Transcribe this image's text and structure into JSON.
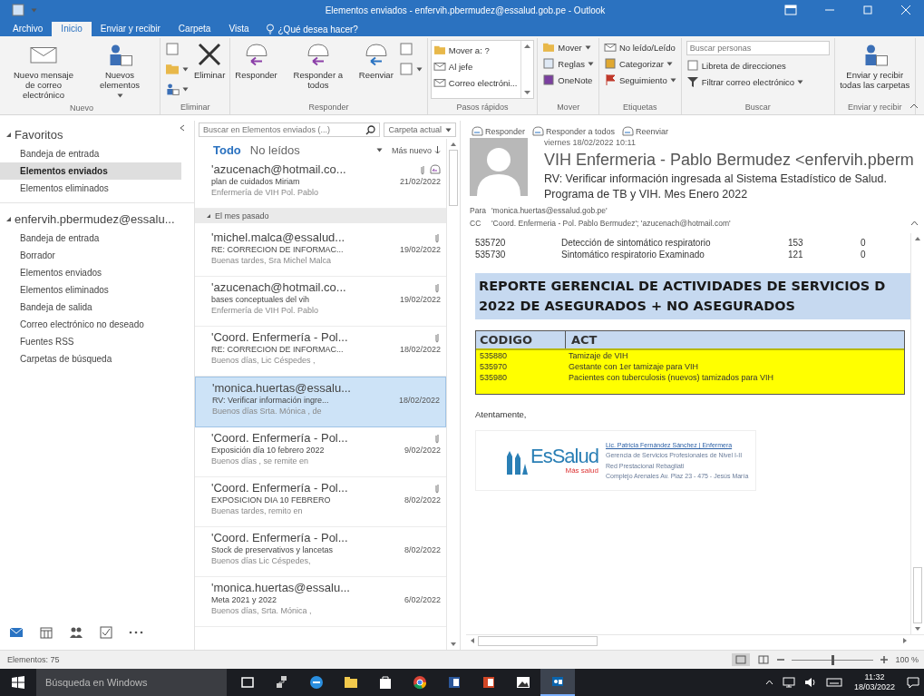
{
  "window": {
    "title": "Elementos enviados - enfervih.pbermudez@essalud.gob.pe - Outlook"
  },
  "ribbon_tabs": [
    {
      "label": "Archivo",
      "selected": false
    },
    {
      "label": "Inicio",
      "selected": true
    },
    {
      "label": "Enviar y recibir",
      "selected": false
    },
    {
      "label": "Carpeta",
      "selected": false
    },
    {
      "label": "Vista",
      "selected": false
    }
  ],
  "tell_me": {
    "placeholder": "¿Qué desea hacer?"
  },
  "ribbon_groups": [
    {
      "label": "Nuevo",
      "boxed": false,
      "buttons": [
        {
          "kind": "large",
          "label": "Nuevo mensaje de correo electrónico",
          "caret": false
        },
        {
          "kind": "large",
          "label": "Nuevos elementos",
          "caret": true
        }
      ]
    },
    {
      "label": "Eliminar",
      "boxed": false,
      "buttons": [
        {
          "kind": "icon",
          "caret": false
        },
        {
          "kind": "icon",
          "caret": true
        },
        {
          "kind": "icon",
          "caret": true
        },
        {
          "kind": "large",
          "label": "Eliminar",
          "caret": false
        }
      ]
    },
    {
      "label": "Responder",
      "boxed": false,
      "buttons": [
        {
          "kind": "large",
          "label": "Responder",
          "caret": false
        },
        {
          "kind": "large",
          "label": "Responder a todos",
          "caret": false
        },
        {
          "kind": "large",
          "label": "Reenviar",
          "caret": false
        },
        {
          "kind": "icon",
          "caret": false
        },
        {
          "kind": "icon",
          "caret": true
        }
      ]
    },
    {
      "label": "Pasos rápidos",
      "boxed": true,
      "buttons": [
        {
          "kind": "small",
          "label": "Mover a: ?",
          "caret": false
        },
        {
          "kind": "small",
          "label": "Al jefe",
          "caret": false
        },
        {
          "kind": "small",
          "label": "Correo electróni...",
          "caret": false
        }
      ]
    },
    {
      "label": "Mover",
      "boxed": false,
      "buttons": [
        {
          "kind": "small",
          "label": "Mover",
          "caret": true
        },
        {
          "kind": "small",
          "label": "Reglas",
          "caret": true
        },
        {
          "kind": "small",
          "label": "OneNote",
          "caret": false
        }
      ]
    },
    {
      "label": "Etiquetas",
      "boxed": false,
      "buttons": [
        {
          "kind": "small",
          "label": "No leído/Leído",
          "caret": false
        },
        {
          "kind": "small",
          "label": "Categorizar",
          "caret": true
        },
        {
          "kind": "small",
          "label": "Seguimiento",
          "caret": true
        }
      ]
    },
    {
      "label": "Buscar",
      "boxed": false,
      "buttons": [
        {
          "kind": "field",
          "placeholder": "Buscar personas"
        },
        {
          "kind": "small",
          "label": "Libreta de direcciones",
          "caret": false
        },
        {
          "kind": "small",
          "label": "Filtrar correo electrónico",
          "caret": true
        }
      ]
    },
    {
      "label": "Enviar y recibir",
      "boxed": false,
      "buttons": [
        {
          "kind": "large",
          "label": "Enviar y recibir todas las carpetas",
          "caret": false
        }
      ]
    }
  ],
  "folder_sections": [
    {
      "title": "Favoritos",
      "expanded": true,
      "items": [
        {
          "label": "Bandeja de entrada",
          "selected": false
        },
        {
          "label": "Elementos enviados",
          "selected": true
        },
        {
          "label": "Elementos eliminados",
          "selected": false
        }
      ]
    },
    {
      "title": "enfervih.pbermudez@essalu...",
      "expanded": true,
      "items": [
        {
          "label": "Bandeja de entrada",
          "selected": false
        },
        {
          "label": "Borrador",
          "selected": false
        },
        {
          "label": "Elementos enviados",
          "selected": false
        },
        {
          "label": "Elementos eliminados",
          "selected": false
        },
        {
          "label": "Bandeja de salida",
          "selected": false
        },
        {
          "label": "Correo electrónico no deseado",
          "selected": false
        },
        {
          "label": "Fuentes RSS",
          "selected": false
        },
        {
          "label": "Carpetas de búsqueda",
          "selected": false
        }
      ]
    }
  ],
  "message_list": {
    "search": {
      "placeholder": "Buscar en Elementos enviados (...)"
    },
    "scope": "Carpeta actual",
    "filters": [
      {
        "label": "Todo",
        "selected": true
      },
      {
        "label": "No leídos",
        "selected": false
      }
    ],
    "sort": "Más nuevo",
    "items": [
      {
        "kind": "message",
        "from": "'azucenach@hotmail.co...",
        "subject": "plan de cuidados Miriam",
        "preview": "Enfermería de VIH Pol. Pablo",
        "date": "21/02/2022",
        "attachment": true,
        "replied": true,
        "selected": false
      },
      {
        "kind": "header",
        "label": "El mes pasado",
        "expanded": true
      },
      {
        "kind": "message",
        "from": "'michel.malca@essalud...",
        "subject": "RE: CORRECION DE INFORMAC...",
        "preview": "Buenas tardes, Sra Michel Malca",
        "date": "19/02/2022",
        "attachment": true,
        "replied": false,
        "selected": false
      },
      {
        "kind": "message",
        "from": "'azucenach@hotmail.co...",
        "subject": "bases conceptuales del vih",
        "preview": "Enfermería de VIH Pol. Pablo",
        "date": "19/02/2022",
        "attachment": true,
        "replied": false,
        "selected": false
      },
      {
        "kind": "message",
        "from": "'Coord. Enfermería - Pol...",
        "subject": "RE: CORRECION DE INFORMAC...",
        "preview": "Buenos días, Lic Céspedes ,",
        "date": "18/02/2022",
        "attachment": true,
        "replied": false,
        "selected": false
      },
      {
        "kind": "message",
        "from": "'monica.huertas@essalu...",
        "subject": "RV: Verificar información ingre...",
        "preview": "Buenos días Srta. Mónica , de",
        "date": "18/02/2022",
        "attachment": false,
        "replied": false,
        "selected": true
      },
      {
        "kind": "message",
        "from": "'Coord. Enfermería - Pol...",
        "subject": "Exposición día 10 febrero 2022",
        "preview": "Buenos días , se remite en",
        "date": "9/02/2022",
        "attachment": true,
        "replied": false,
        "selected": false
      },
      {
        "kind": "message",
        "from": "'Coord. Enfermería - Pol...",
        "subject": "EXPOSICION DIA 10 FEBRERO",
        "preview": "Buenas tardes, remito en",
        "date": "8/02/2022",
        "attachment": true,
        "replied": false,
        "selected": false
      },
      {
        "kind": "message",
        "from": "'Coord. Enfermería - Pol...",
        "subject": "Stock de preservativos y lancetas",
        "preview": "Buenos días Lic Céspedes,",
        "date": "8/02/2022",
        "attachment": false,
        "replied": false,
        "selected": false
      },
      {
        "kind": "message",
        "from": "'monica.huertas@essalu...",
        "subject": "Meta 2021 y 2022",
        "preview": "Buenos días, Srta. Mónica ,",
        "date": "6/02/2022",
        "attachment": false,
        "replied": false,
        "selected": false
      }
    ]
  },
  "reading_pane": {
    "actions": [
      "Responder",
      "Responder a todos",
      "Reenviar"
    ],
    "date": "viernes 18/02/2022 10:11",
    "from": "VIH Enfermeria - Pablo Bermudez <enfervih.pberm",
    "subject": "RV: Verificar información ingresada al Sistema Estadístico de Salud. Programa de TB y VIH. Mes Enero 2022",
    "to_label": "Para",
    "to": "'monica.huertas@essalud.gob.pe'",
    "cc_label": "CC",
    "cc": "'Coord. Enfermeria - Pol. Pablo Bermudez'; 'azucenach@hotmail.com'",
    "body": {
      "data_rows": [
        {
          "code": "535720",
          "description": "Detección de sintomático respiratorio",
          "column_3": "153",
          "column_4": "0"
        },
        {
          "code": "535730",
          "description": "Sintomático respiratorio Examinado",
          "column_3": "121",
          "column_4": "0"
        }
      ],
      "banner": [
        "REPORTE GERENCIAL DE ACTIVIDADES DE SERVICIOS D",
        "2022  DE  ASEGURADOS + NO ASEGURADOS"
      ],
      "activity_table": {
        "columns": [
          "CODIGO",
          "ACT"
        ],
        "rows": [
          [
            "535880",
            "Tamizaje de VIH"
          ],
          [
            "535970",
            "Gestante con 1er tamizaje para VIH"
          ],
          [
            "535980",
            "Pacientes con tuberculosis (nuevos) tamizados para VIH"
          ]
        ]
      },
      "closing": "Atentamente,",
      "signature": {
        "logo": "EsSalud",
        "tagline": "Más salud",
        "lines": [
          "Lic. Patricia Fernández Sánchez | Enfermera",
          "Gerencia de Servicios Profesionales de Nivel I-II",
          "Red Prestacional Rebagliati",
          "Complejo Arenales Av. Plaz 23 - 475 - Jesús María"
        ]
      }
    }
  },
  "status_bar": {
    "count": "Elementos: 75",
    "zoom": {
      "level": 0.5,
      "reading": "100 %"
    }
  },
  "taskbar": {
    "search": {
      "placeholder": "Búsqueda en Windows"
    },
    "apps": [
      {
        "active": false
      },
      {
        "active": false
      },
      {
        "active": false
      },
      {
        "active": false
      },
      {
        "active": false
      },
      {
        "active": false
      },
      {
        "active": false
      },
      {
        "active": false
      },
      {
        "active": false
      },
      {
        "active": true
      }
    ],
    "time": "11:32",
    "date": "18/03/2022"
  }
}
